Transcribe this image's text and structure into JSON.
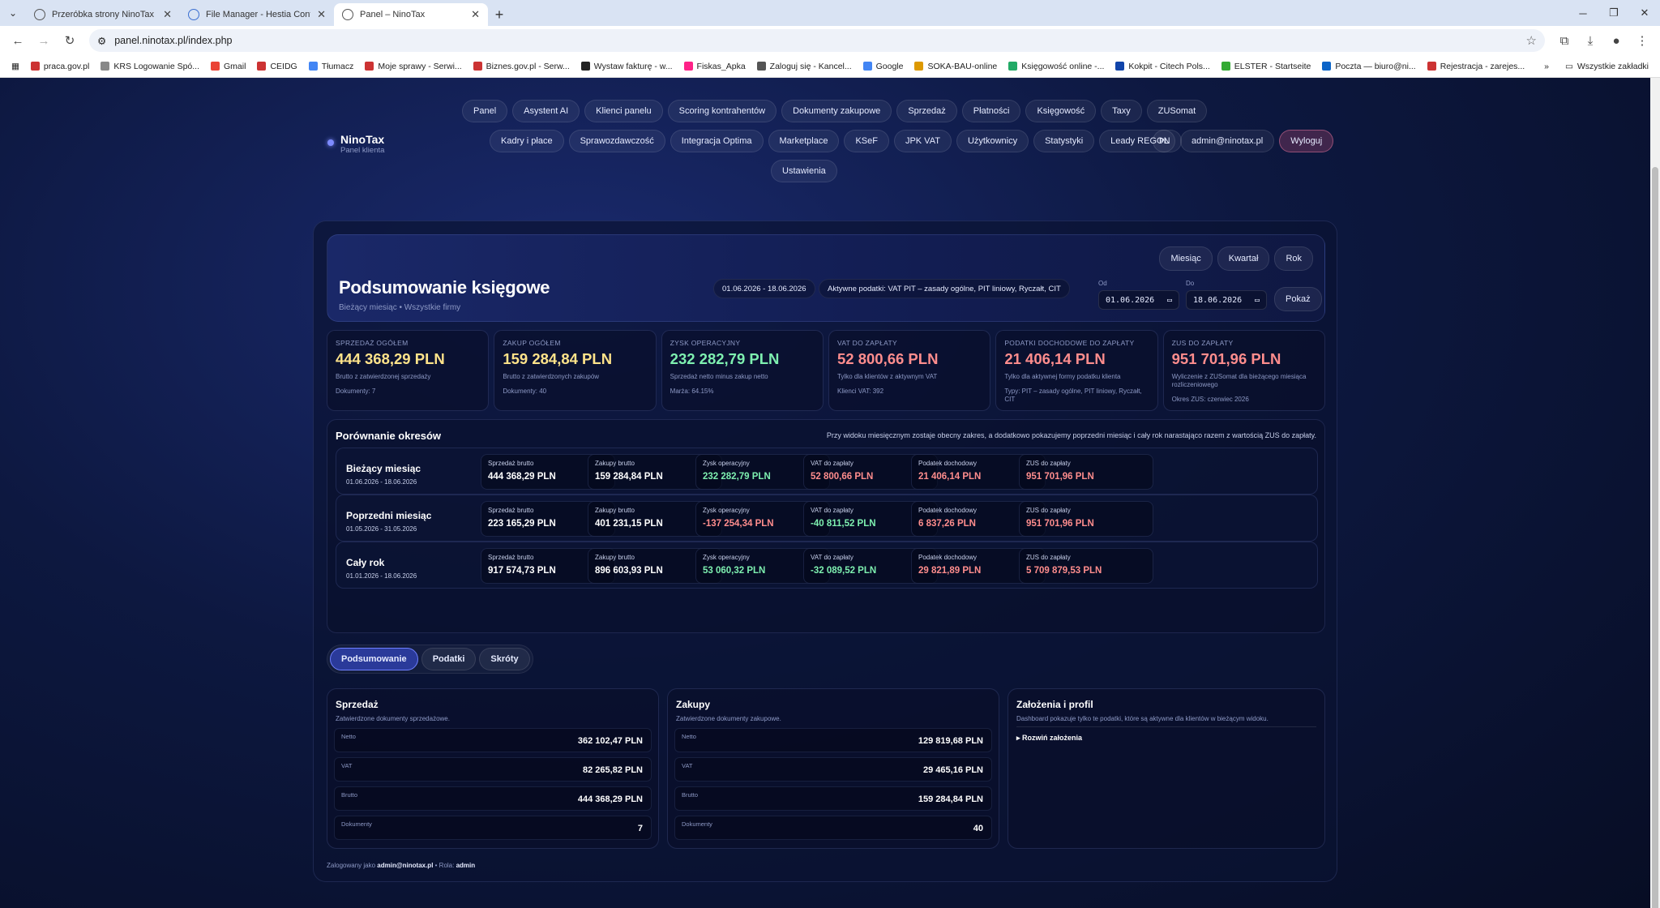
{
  "browser": {
    "tabs": [
      {
        "title": "Przeróbka strony NinoTax"
      },
      {
        "title": "File Manager - Hestia Control P..."
      },
      {
        "title": "Panel – NinoTax"
      }
    ],
    "url": "panel.ninotax.pl/index.php",
    "bookmarks": [
      "praca.gov.pl",
      "KRS Logowanie Spó...",
      "Gmail",
      "CEIDG",
      "Tłumacz",
      "Moje sprawy - Serwi...",
      "Biznes.gov.pl - Serw...",
      "Wystaw fakturę - w...",
      "Fiskas_Apka",
      "Zaloguj się - Kancel...",
      "Google",
      "SOKA-BAU-online",
      "Księgowość online -...",
      "Kokpit - Citech Pols...",
      "ELSTER - Startseite",
      "Poczta — biuro@ni...",
      "Rejestracja - zarejes..."
    ],
    "all_bookmarks": "Wszystkie zakładki"
  },
  "brand": {
    "name": "NinoTax",
    "sub": "Panel klienta"
  },
  "nav": {
    "row1": [
      "Panel",
      "Asystent AI",
      "Klienci panelu",
      "Scoring kontrahentów",
      "Dokumenty zakupowe",
      "Sprzedaż",
      "Płatności",
      "Księgowość",
      "Taxy",
      "ZUSomat"
    ],
    "row2": [
      "Kadry i płace",
      "Sprawozdawczość",
      "Integracja Optima",
      "Marketplace",
      "KSeF",
      "JPK VAT",
      "Użytkownicy",
      "Statystyki",
      "Leady REGON"
    ],
    "row3": [
      "Ustawienia"
    ],
    "lang": "PL",
    "user": "admin@ninotax.pl",
    "logout": "Wyloguj"
  },
  "hero": {
    "title": "Podsumowanie księgowe",
    "sub": "Bieżący miesiąc • Wszystkie firmy",
    "range": "01.06.2026 - 18.06.2026",
    "taxes": "Aktywne podatki: VAT PIT – zasady ogólne, PIT liniowy, Ryczałt, CIT",
    "periods": [
      "Miesiąc",
      "Kwartał",
      "Rok"
    ],
    "from_label": "Od",
    "to_label": "Do",
    "from": "01.06.2026",
    "to": "18.06.2026",
    "show": "Pokaż"
  },
  "kpis": [
    {
      "label": "Sprzedaż ogółem",
      "value": "444 368,29 PLN",
      "desc": "Brutto z zatwierdzonej sprzedaży",
      "extra": "Dokumenty: 7",
      "color": "#ffe38a"
    },
    {
      "label": "Zakup ogółem",
      "value": "159 284,84 PLN",
      "desc": "Brutto z zatwierdzonych zakupów",
      "extra": "Dokumenty: 40",
      "color": "#ffe38a"
    },
    {
      "label": "Zysk operacyjny",
      "value": "232 282,79 PLN",
      "desc": "Sprzedaż netto minus zakup netto",
      "extra": "Marża: 64.15%",
      "color": "#7ef0b0"
    },
    {
      "label": "VAT do zapłaty",
      "value": "52 800,66 PLN",
      "desc": "Tylko dla klientów z aktywnym VAT",
      "extra": "Klienci VAT: 392",
      "color": "#ff8d8d"
    },
    {
      "label": "Podatki dochodowe do zapłaty",
      "value": "21 406,14 PLN",
      "desc": "Tylko dla aktywnej formy podatku klienta",
      "extra": "Typy: PIT – zasady ogólne, PIT liniowy, Ryczałt, CIT",
      "color": "#ff8d8d"
    },
    {
      "label": "ZUS do zapłaty",
      "value": "951 701,96 PLN",
      "desc": "Wyliczenie z ZUSomat dla bieżącego miesiąca rozliczeniowego",
      "extra": "Okres ZUS: czerwiec 2026",
      "color": "#ff8d8d"
    }
  ],
  "compare": {
    "title": "Porównanie okresów",
    "note": "Przy widoku miesięcznym zostaje obecny zakres, a dodatkowo pokazujemy poprzedni miesiąc i cały rok narastająco razem z wartością ZUS do zapłaty.",
    "rows": [
      {
        "title": "Bieżący miesiąc",
        "dates": "01.06.2026 - 18.06.2026",
        "cells": [
          {
            "label": "Sprzedaż brutto",
            "value": "444 368,29 PLN",
            "color": "#ffffff"
          },
          {
            "label": "Zakupy brutto",
            "value": "159 284,84 PLN",
            "color": "#ffffff"
          },
          {
            "label": "Zysk operacyjny",
            "value": "232 282,79 PLN",
            "color": "#7ef0b0"
          },
          {
            "label": "VAT do zapłaty",
            "value": "52 800,66 PLN",
            "color": "#ff8d8d"
          },
          {
            "label": "Podatek dochodowy",
            "value": "21 406,14 PLN",
            "color": "#ff8d8d"
          },
          {
            "label": "ZUS do zapłaty",
            "value": "951 701,96 PLN",
            "color": "#ff8d8d"
          }
        ]
      },
      {
        "title": "Poprzedni miesiąc",
        "dates": "01.05.2026 - 31.05.2026",
        "cells": [
          {
            "label": "Sprzedaż brutto",
            "value": "223 165,29 PLN",
            "color": "#ffffff"
          },
          {
            "label": "Zakupy brutto",
            "value": "401 231,15 PLN",
            "color": "#ffffff"
          },
          {
            "label": "Zysk operacyjny",
            "value": "-137 254,34 PLN",
            "color": "#ff8d8d"
          },
          {
            "label": "VAT do zapłaty",
            "value": "-40 811,52 PLN",
            "color": "#7ef0b0"
          },
          {
            "label": "Podatek dochodowy",
            "value": "6 837,26 PLN",
            "color": "#ff8d8d"
          },
          {
            "label": "ZUS do zapłaty",
            "value": "951 701,96 PLN",
            "color": "#ff8d8d"
          }
        ]
      },
      {
        "title": "Cały rok",
        "dates": "01.01.2026 - 18.06.2026",
        "cells": [
          {
            "label": "Sprzedaż brutto",
            "value": "917 574,73 PLN",
            "color": "#ffffff"
          },
          {
            "label": "Zakupy brutto",
            "value": "896 603,93 PLN",
            "color": "#ffffff"
          },
          {
            "label": "Zysk operacyjny",
            "value": "53 060,32 PLN",
            "color": "#7ef0b0"
          },
          {
            "label": "VAT do zapłaty",
            "value": "-32 089,52 PLN",
            "color": "#7ef0b0"
          },
          {
            "label": "Podatek dochodowy",
            "value": "29 821,89 PLN",
            "color": "#ff8d8d"
          },
          {
            "label": "ZUS do zapłaty",
            "value": "5 709 879,53 PLN",
            "color": "#ff8d8d"
          }
        ]
      }
    ]
  },
  "tabs": [
    "Podsumowanie",
    "Podatki",
    "Skróty"
  ],
  "sales": {
    "title": "Sprzedaż",
    "desc": "Zatwierdzone dokumenty sprzedażowe.",
    "rows": [
      {
        "label": "Netto",
        "value": "362 102,47 PLN"
      },
      {
        "label": "VAT",
        "value": "82 265,82 PLN"
      },
      {
        "label": "Brutto",
        "value": "444 368,29 PLN"
      },
      {
        "label": "Dokumenty",
        "value": "7"
      }
    ]
  },
  "purchases": {
    "title": "Zakupy",
    "desc": "Zatwierdzone dokumenty zakupowe.",
    "rows": [
      {
        "label": "Netto",
        "value": "129 819,68 PLN"
      },
      {
        "label": "VAT",
        "value": "29 465,16 PLN"
      },
      {
        "label": "Brutto",
        "value": "159 284,84 PLN"
      },
      {
        "label": "Dokumenty",
        "value": "40"
      }
    ]
  },
  "assumptions": {
    "title": "Założenia i profil",
    "desc": "Dashboard pokazuje tylko te podatki, które są aktywne dla klientów w bieżącym widoku.",
    "toggle": "▸ Rozwiń założenia"
  },
  "footer": {
    "prefix": "Zalogowany jako",
    "user": "admin@ninotax.pl",
    "role_prefix": "• Rola:",
    "role": "admin"
  }
}
